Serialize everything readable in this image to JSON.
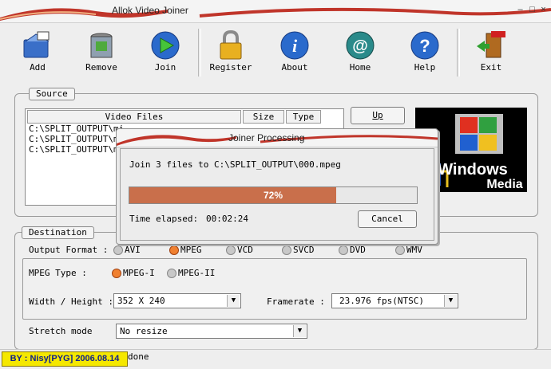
{
  "app": {
    "title": "Allok Video Joiner",
    "sys_min": "–",
    "sys_max": "□",
    "sys_close": "×"
  },
  "toolbar": [
    {
      "label": "Add",
      "icon": "folder-add-icon"
    },
    {
      "label": "Remove",
      "icon": "trash-can-icon"
    },
    {
      "label": "Join",
      "icon": "play-circle-icon"
    },
    {
      "label": "Register",
      "icon": "padlock-icon"
    },
    {
      "label": "About",
      "icon": "info-icon"
    },
    {
      "label": "Home",
      "icon": "at-sign-icon"
    },
    {
      "label": "Help",
      "icon": "question-icon"
    },
    {
      "label": "Exit",
      "icon": "exit-door-icon"
    }
  ],
  "source": {
    "legend": "Source",
    "columns": [
      "Video Files",
      "Size",
      "Type"
    ],
    "rows": [
      "C:\\SPLIT_OUTPUT\\mi",
      "C:\\SPLIT_OUTPUT\\mi",
      "C:\\SPLIT_OUTPUT\\mi"
    ],
    "up_button": "Up"
  },
  "windows_logo_text": {
    "line1": "Windows",
    "line2": "Media"
  },
  "destination": {
    "legend": "Destination",
    "output_format_label": "Output Format :",
    "formats": [
      "AVI",
      "MPEG",
      "VCD",
      "SVCD",
      "DVD",
      "WMV"
    ],
    "selected_format": "MPEG",
    "mpeg_type_label": "MPEG Type :",
    "mpeg_types": [
      "MPEG-I",
      "MPEG-II"
    ],
    "selected_mpeg_type": "MPEG-I",
    "width_height_label": "Width / Height :",
    "width_height_value": "352 X 240",
    "framerate_label": "Framerate :",
    "framerate_value": "23.976 fps(NTSC)",
    "stretch_label": "Stretch mode",
    "stretch_value": "No resize"
  },
  "dialog": {
    "title": "Joiner Processing",
    "message": "Join 3 files to C:\\SPLIT_OUTPUT\\000.mpeg",
    "progress_percent": 72,
    "progress_text": "72%",
    "elapsed_label": "Time elapsed:",
    "elapsed_value": "00:02:24",
    "cancel_button": "Cancel"
  },
  "status": {
    "badge": "BY : Nisy[PYG] 2006.08.14",
    "text": "done"
  },
  "colors": {
    "progress_fill": "#c96f4b",
    "radio_selected": "#f08030",
    "badge_bg": "#f5e800",
    "swoosh": "#c0352a"
  }
}
